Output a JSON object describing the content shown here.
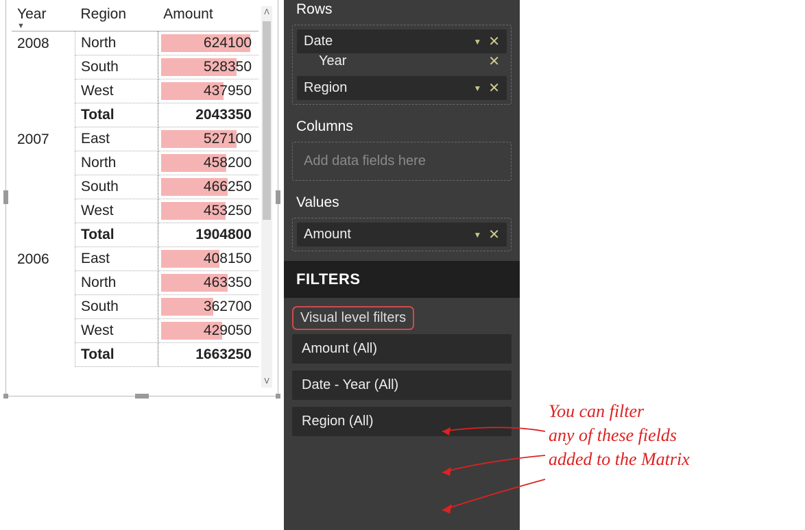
{
  "matrix": {
    "headers": {
      "year": "Year",
      "region": "Region",
      "amount": "Amount"
    },
    "sort_indicator": "▼",
    "max_amount": 700000,
    "groups": [
      {
        "year": "2008",
        "rows": [
          {
            "region": "North",
            "amount": 624100
          },
          {
            "region": "South",
            "amount": 528350
          },
          {
            "region": "West",
            "amount": 437950
          }
        ],
        "total_label": "Total",
        "total": 2043350
      },
      {
        "year": "2007",
        "rows": [
          {
            "region": "East",
            "amount": 527100
          },
          {
            "region": "North",
            "amount": 458200
          },
          {
            "region": "South",
            "amount": 466250
          },
          {
            "region": "West",
            "amount": 453250
          }
        ],
        "total_label": "Total",
        "total": 1904800
      },
      {
        "year": "2006",
        "rows": [
          {
            "region": "East",
            "amount": 408150
          },
          {
            "region": "North",
            "amount": 463350
          },
          {
            "region": "South",
            "amount": 362700
          },
          {
            "region": "West",
            "amount": 429050
          }
        ],
        "total_label": "Total",
        "total": 1663250
      }
    ]
  },
  "panel": {
    "rows_label": "Rows",
    "columns_label": "Columns",
    "columns_placeholder": "Add data fields here",
    "values_label": "Values",
    "rows_fields": {
      "date": "Date",
      "year": "Year",
      "region": "Region"
    },
    "values_fields": {
      "amount": "Amount"
    },
    "filters_header": "FILTERS",
    "vlf_title": "Visual level filters",
    "filters": [
      "Amount  (All)",
      "Date - Year  (All)",
      "Region  (All)"
    ]
  },
  "annotation": "You can filter\nany of these fields\nadded to the Matrix"
}
